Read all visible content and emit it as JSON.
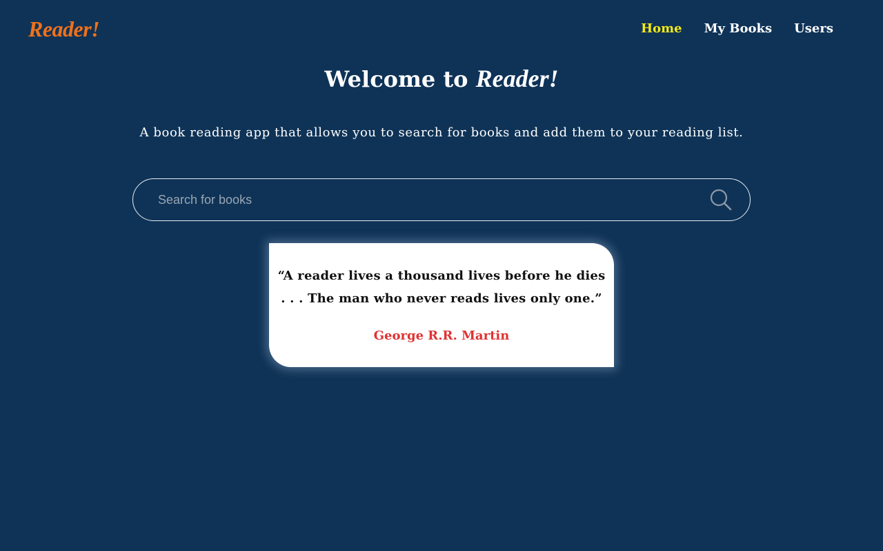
{
  "header": {
    "logo": "Reader!",
    "nav": [
      {
        "label": "Home",
        "active": true
      },
      {
        "label": "My Books",
        "active": false
      },
      {
        "label": "Users",
        "active": false
      }
    ]
  },
  "hero": {
    "title_prefix": "Welcome to ",
    "title_brand": "Reader!",
    "subtitle": "A book reading app that allows you to search for books and add them to your reading list."
  },
  "search": {
    "value": "",
    "placeholder": "Search for books",
    "icon": "search-icon"
  },
  "quote": {
    "line1": "“A reader lives a thousand lives before he dies",
    "line2": ". . . The man who never reads lives only one.”",
    "author": "George R.R. Martin"
  },
  "colors": {
    "background": "#0f3357",
    "logo": "#f0711a",
    "nav_active": "#f5ea14",
    "quote_author": "#e03232",
    "card": "#ffffff"
  }
}
